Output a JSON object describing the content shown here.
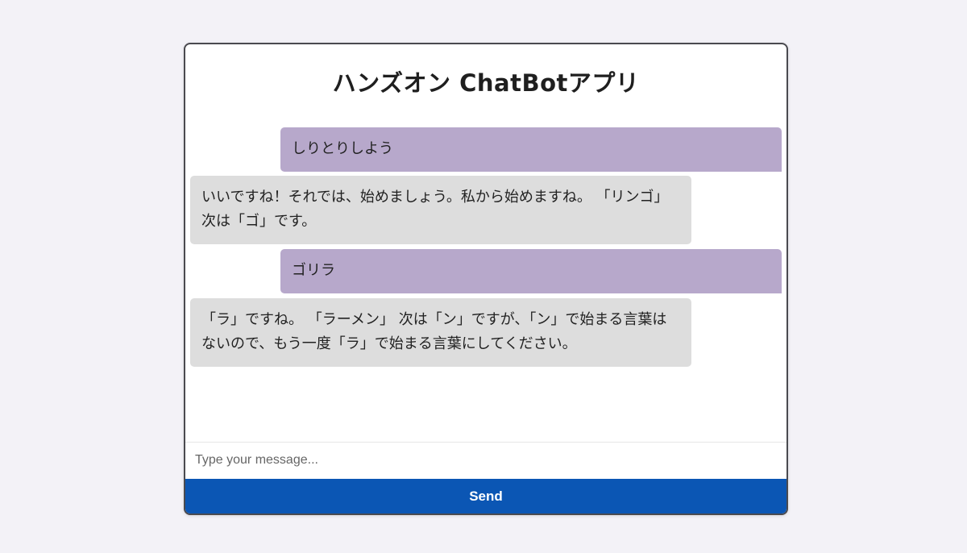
{
  "app": {
    "title": "ハンズオン ChatBotアプリ"
  },
  "messages": [
    {
      "role": "user",
      "text": "しりとりしよう"
    },
    {
      "role": "bot",
      "text": "いいですね！それでは、始めましょう。私から始めますね。 「リンゴ」 次は「ゴ」です。"
    },
    {
      "role": "user",
      "text": "ゴリラ"
    },
    {
      "role": "bot",
      "text": "「ラ」ですね。 「ラーメン」 次は「ン」ですが、「ン」で始まる言葉はないので、もう一度「ラ」で始まる言葉にしてください。"
    }
  ],
  "input": {
    "placeholder": "Type your message...",
    "value": ""
  },
  "send_button": {
    "label": "Send"
  },
  "colors": {
    "page_background": "#f3f2f7",
    "user_bubble": "#b7a8cb",
    "bot_bubble": "#dddddd",
    "send_button": "#0b56b4"
  }
}
